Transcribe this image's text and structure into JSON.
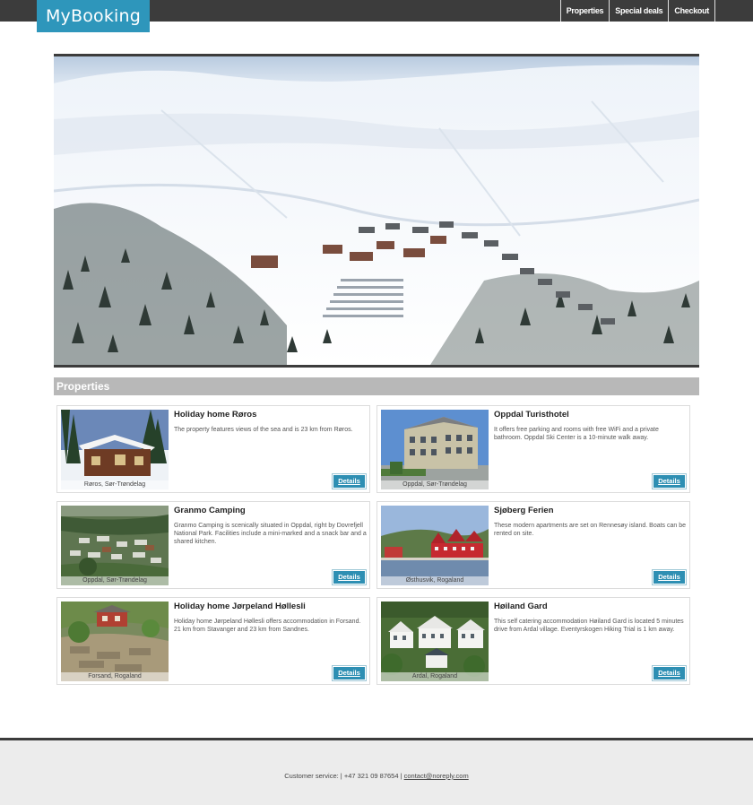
{
  "header": {
    "logo": "MyBooking",
    "nav": [
      "Properties",
      "Special deals",
      "Checkout"
    ]
  },
  "section": {
    "title": "Properties"
  },
  "properties": [
    {
      "title": "Holiday home Røros",
      "description": "The property features views of the sea and is 23 km from Røros.",
      "location": "Røros, Sør-Trøndelag",
      "details_label": "Details"
    },
    {
      "title": "Oppdal Turisthotel",
      "description": "It offers free parking and rooms with free WiFi and a private bathroom. Oppdal Ski Center is a 10-minute walk away.",
      "location": "Oppdal, Sør-Trøndelag",
      "details_label": "Details"
    },
    {
      "title": "Granmo Camping",
      "description": "Granmo Camping is scenically situated in Oppdal, right by Dovrefjell National Park. Facilities include a mini-marked and a snack bar and a shared kitchen.",
      "location": "Oppdal, Sør-Trøndelag",
      "details_label": "Details"
    },
    {
      "title": "Sjøberg Ferien",
      "description": "These modern apartments are set on Rennesøy island. Boats can be rented on site.",
      "location": "Østhusvik, Rogaland",
      "details_label": "Details"
    },
    {
      "title": "Holiday home Jørpeland Høllesli",
      "description": "Holiday home Jørpeland Høllesli offers accommodation in Forsand. 21 km from Stavanger and 23 km from Sandnes.",
      "location": "Forsand, Rogaland",
      "details_label": "Details"
    },
    {
      "title": "Høiland Gard",
      "description": "This self catering accommodation Høiland Gard is located 5 minutes drive from Ardal village. Eventyrskogen Hiking Trial is 1 km away.",
      "location": "Ardal, Rogaland",
      "details_label": "Details"
    }
  ],
  "footer": {
    "prefix": "Customer service: | +47 321 09 87654 |",
    "email": "contact@noreply.com"
  },
  "colors": {
    "accent": "#2e96bb",
    "topbar": "#3c3c3c",
    "section_bar": "#b8b8b8",
    "footer_bg": "#ececec"
  }
}
